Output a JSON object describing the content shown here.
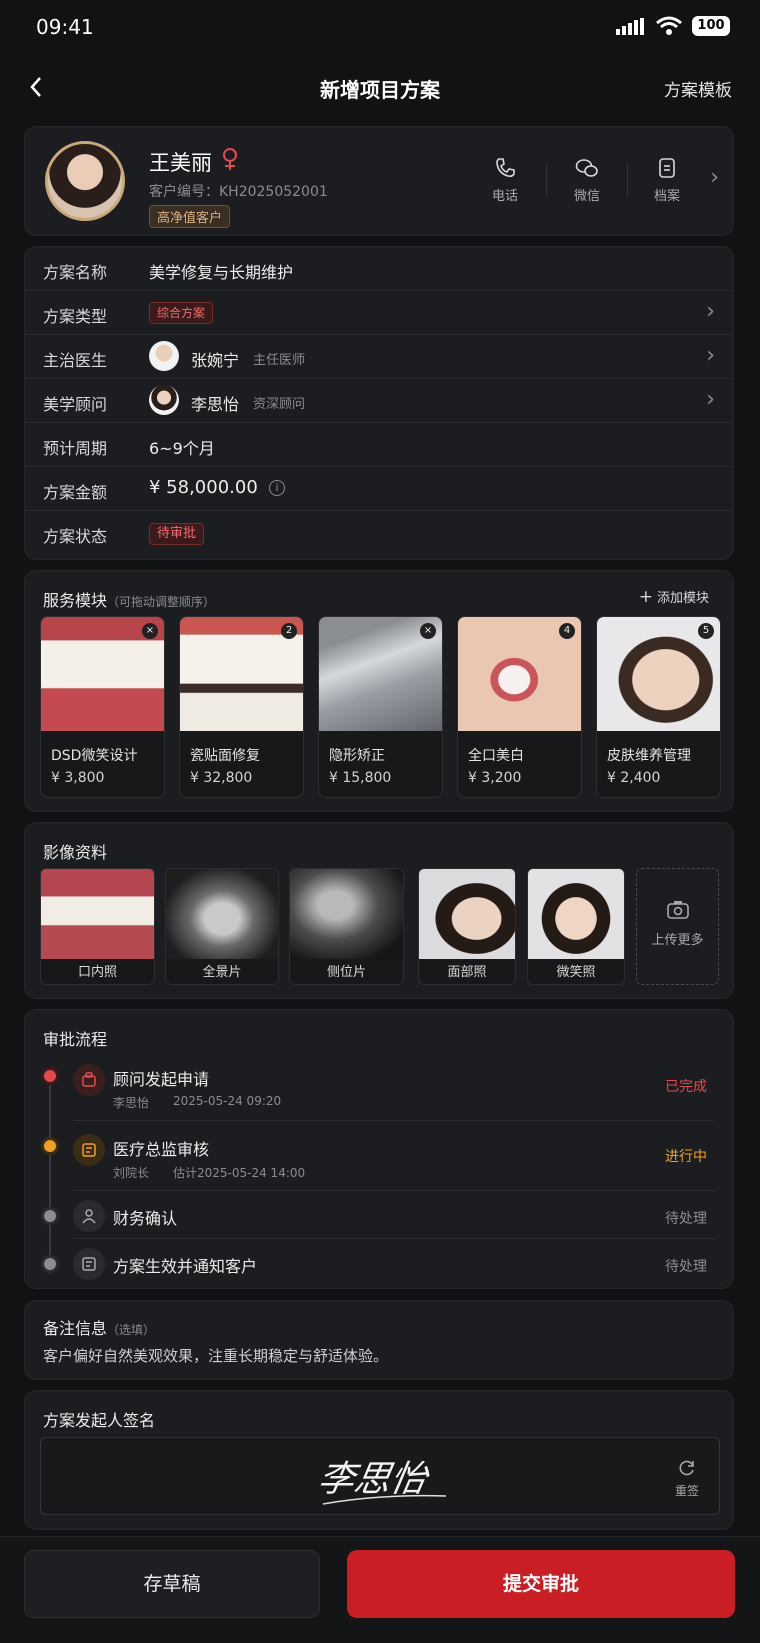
{
  "status_bar": {
    "time": "09:41",
    "battery": "100"
  },
  "nav": {
    "title": "新增项目方案",
    "right": "方案模板",
    "back_icon": "chevron-left"
  },
  "customer": {
    "name": "王美丽",
    "gender_icon": "female",
    "id_label": "客户编号：",
    "id": "KH2025052001",
    "badge": "高净值客户",
    "actions": [
      {
        "label": "电话",
        "icon": "phone"
      },
      {
        "label": "微信",
        "icon": "wechat"
      },
      {
        "label": "档案",
        "icon": "file"
      }
    ]
  },
  "plan": {
    "name_label": "方案名称",
    "name": "美学修复与长期维护",
    "type_label": "方案类型",
    "type": "综合方案",
    "doctor_label": "主治医生",
    "doctor": "张婉宁",
    "doctor_title": "主任医师",
    "advisor_label": "美学顾问",
    "advisor": "李思怡",
    "advisor_title": "资深顾问",
    "period_label": "预计周期",
    "period": "6~9个月",
    "amount_label": "方案金额",
    "amount": "¥ 58,000.00",
    "status_label": "方案状态",
    "status": "待审批"
  },
  "modules": {
    "title": "服务模块",
    "hint": "（可拖动调整顺序）",
    "add": "添加模块",
    "items": [
      {
        "name": "DSD微笑设计",
        "price": "¥ 3,800",
        "badge": "×"
      },
      {
        "name": "瓷贴面修复",
        "price": "¥ 32,800",
        "badge": "2"
      },
      {
        "name": "隐形矫正",
        "price": "¥ 15,800",
        "badge": "×"
      },
      {
        "name": "全口美白",
        "price": "¥ 3,200",
        "badge": "4"
      },
      {
        "name": "皮肤维养管理",
        "price": "¥ 2,400",
        "badge": "5"
      }
    ]
  },
  "images": {
    "title": "影像资料",
    "items": [
      {
        "label": "口内照"
      },
      {
        "label": "全景片"
      },
      {
        "label": "侧位片"
      },
      {
        "label": "面部照"
      },
      {
        "label": "微笑照"
      }
    ],
    "upload": "上传更多"
  },
  "approval": {
    "title": "审批流程",
    "steps": [
      {
        "name": "顾问发起申请",
        "person": "李思怡",
        "time": "2025-05-24 09:20",
        "status": "已完成",
        "color": "#e5484d"
      },
      {
        "name": "医疗总监审核",
        "person": "刘院长",
        "time": "估计2025-05-24 14:00",
        "status": "进行中",
        "color": "#f0a020"
      },
      {
        "name": "财务确认",
        "person": "",
        "time": "",
        "status": "待处理",
        "color": "#8b8c90"
      },
      {
        "name": "方案生效并通知客户",
        "person": "",
        "time": "",
        "status": "待处理",
        "color": "#8b8c90"
      }
    ]
  },
  "remark": {
    "title": "备注信息",
    "hint": "（选填）",
    "text": "客户偏好自然美观效果，注重长期稳定与舒适体验。"
  },
  "signature": {
    "title": "方案发起人签名",
    "sign": "李思怡",
    "reset": "重签"
  },
  "footer": {
    "draft": "存草稿",
    "submit": "提交审批"
  }
}
